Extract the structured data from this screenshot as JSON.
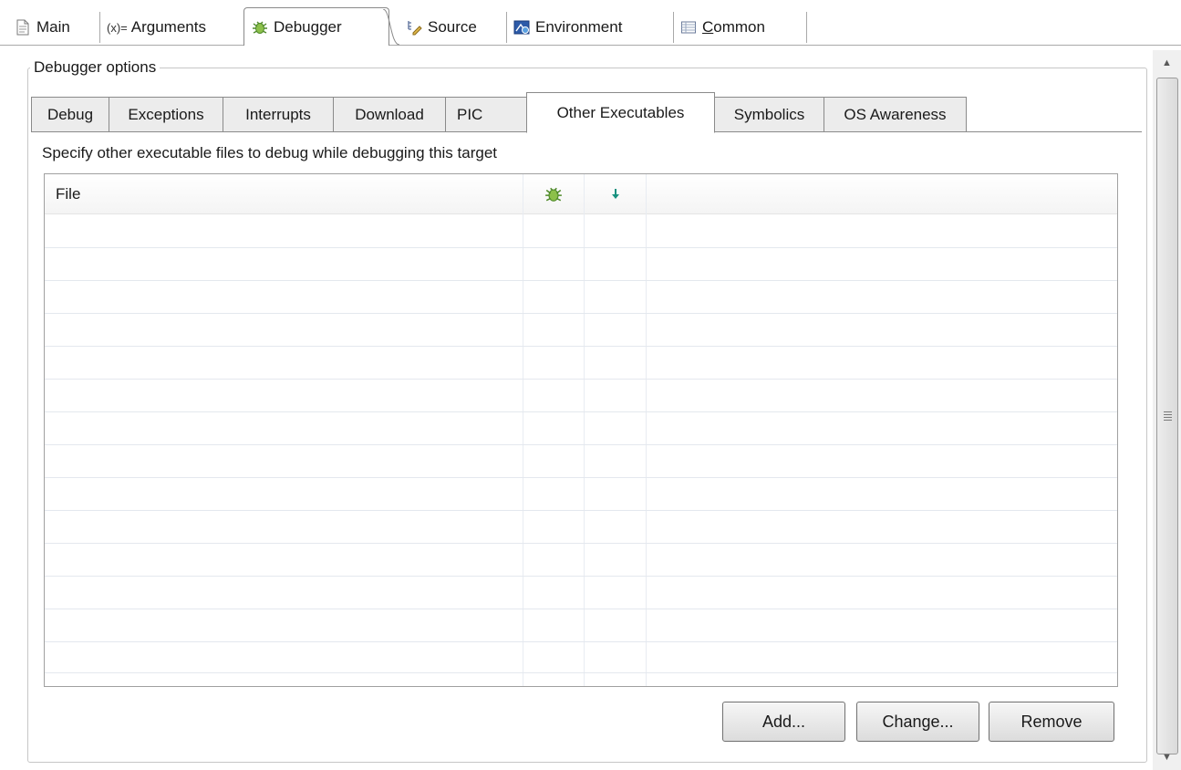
{
  "top_tabs": [
    {
      "label": "Main",
      "icon": "document-icon",
      "active": false
    },
    {
      "label": "Arguments",
      "prefix": "(x)=",
      "icon": "variable-icon",
      "active": false
    },
    {
      "label": "Debugger",
      "icon": "bug-icon",
      "active": true
    },
    {
      "label": "Source",
      "icon": "source-lookup-icon",
      "active": false
    },
    {
      "label": "Environment",
      "icon": "environment-icon",
      "active": false
    },
    {
      "label_first": "C",
      "label_rest": "ommon",
      "icon": "common-icon",
      "active": false
    }
  ],
  "group": {
    "legend": "Debugger options"
  },
  "inner_tabs": [
    {
      "label": "Debug",
      "active": false
    },
    {
      "label": "Exceptions",
      "active": false
    },
    {
      "label": "Interrupts",
      "active": false
    },
    {
      "label": "Download",
      "active": false
    },
    {
      "label": "PIC",
      "active": false
    },
    {
      "label": "Other Executables",
      "active": true
    },
    {
      "label": "Symbolics",
      "active": false
    },
    {
      "label": "OS Awareness",
      "active": false
    }
  ],
  "description": "Specify other executable files to debug while debugging this target",
  "table": {
    "columns": [
      {
        "label": "File"
      },
      {
        "icon": "bug-icon"
      },
      {
        "icon": "download-arrow-icon"
      },
      {
        "label": ""
      }
    ],
    "rows": []
  },
  "buttons": {
    "add": "Add...",
    "change": "Change...",
    "remove": "Remove"
  },
  "colors": {
    "bug_green": "#4f8a2a",
    "download_teal": "#17917f",
    "border": "#a0a0a0"
  }
}
